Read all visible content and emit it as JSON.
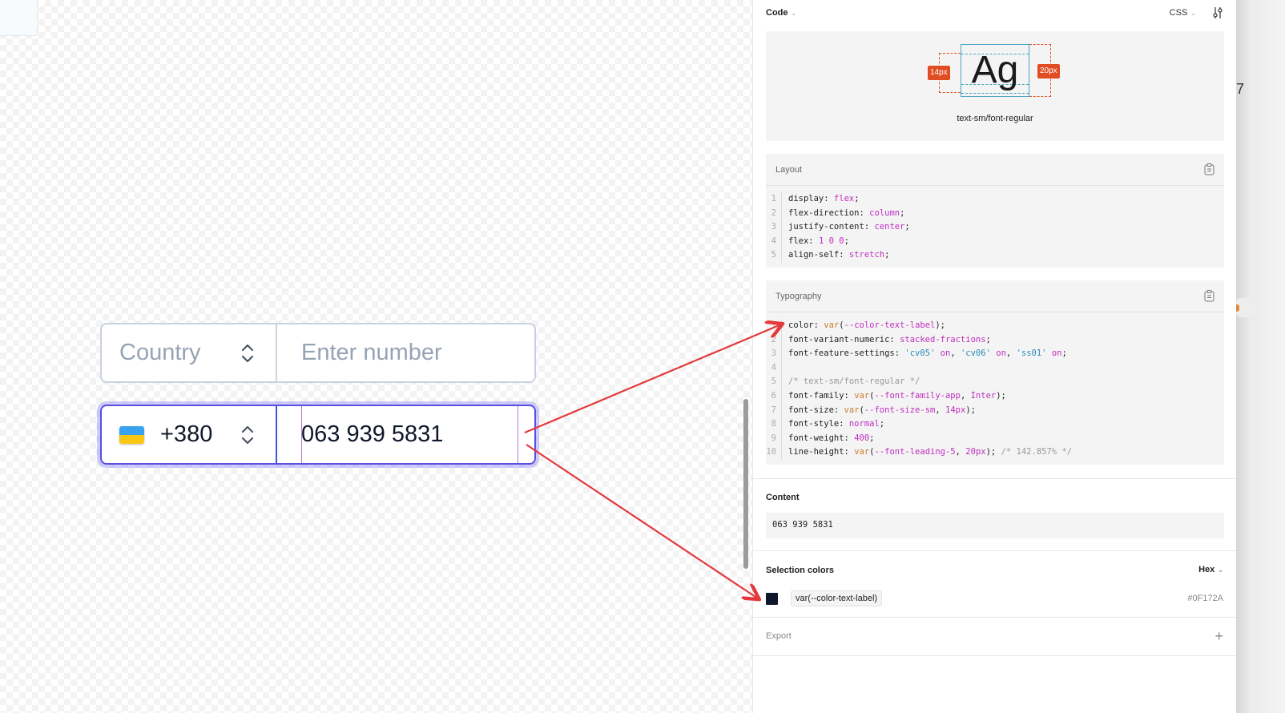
{
  "canvas": {
    "empty_field": {
      "country_placeholder": "Country",
      "number_placeholder": "Enter number"
    },
    "filled_field": {
      "flag": "ukraine-flag",
      "dial_code": "+380",
      "number_value": "063 939 5831"
    }
  },
  "panel": {
    "header": {
      "title": "Code",
      "language": "CSS"
    },
    "preview": {
      "sample_text": "Ag",
      "font_size_badge": "14px",
      "line_height_badge": "20px",
      "style_name": "text-sm/font-regular"
    },
    "layout": {
      "title": "Layout",
      "lines": [
        {
          "n": "1",
          "prop": "display",
          "value": "flex"
        },
        {
          "n": "2",
          "prop": "flex-direction",
          "value": "column"
        },
        {
          "n": "3",
          "prop": "justify-content",
          "value": "center"
        },
        {
          "n": "4",
          "prop": "flex",
          "value": "1 0 0"
        },
        {
          "n": "5",
          "prop": "align-self",
          "value": "stretch"
        }
      ]
    },
    "typography": {
      "title": "Typography",
      "lines": [
        {
          "n": "1",
          "text": "color: var(--color-text-label);"
        },
        {
          "n": "2",
          "text": "font-variant-numeric: stacked-fractions;"
        },
        {
          "n": "3",
          "text": "font-feature-settings: 'cv05' on, 'cv06' on, 'ss01' on;"
        },
        {
          "n": "4",
          "text": ""
        },
        {
          "n": "5",
          "text": "/* text-sm/font-regular */"
        },
        {
          "n": "6",
          "text": "font-family: var(--font-family-app, Inter);"
        },
        {
          "n": "7",
          "text": "font-size: var(--font-size-sm, 14px);"
        },
        {
          "n": "8",
          "text": "font-style: normal;"
        },
        {
          "n": "9",
          "text": "font-weight: 400;"
        },
        {
          "n": "10",
          "text": "line-height: var(--font-leading-5, 20px); /* 142.857% */"
        }
      ]
    },
    "content": {
      "title": "Content",
      "value": "063 939 5831"
    },
    "selection_colors": {
      "title": "Selection colors",
      "format": "Hex",
      "items": [
        {
          "variable": "var(--color-text-label)",
          "hex": "#0F172A"
        }
      ]
    },
    "export": {
      "title": "Export"
    }
  },
  "background_fragment": "7",
  "colors": {
    "accent_focus": "#5A4FE0",
    "annotation_arrow": "#E5383B",
    "measure_badge": "#E14D22",
    "text_label": "#0F172A"
  }
}
